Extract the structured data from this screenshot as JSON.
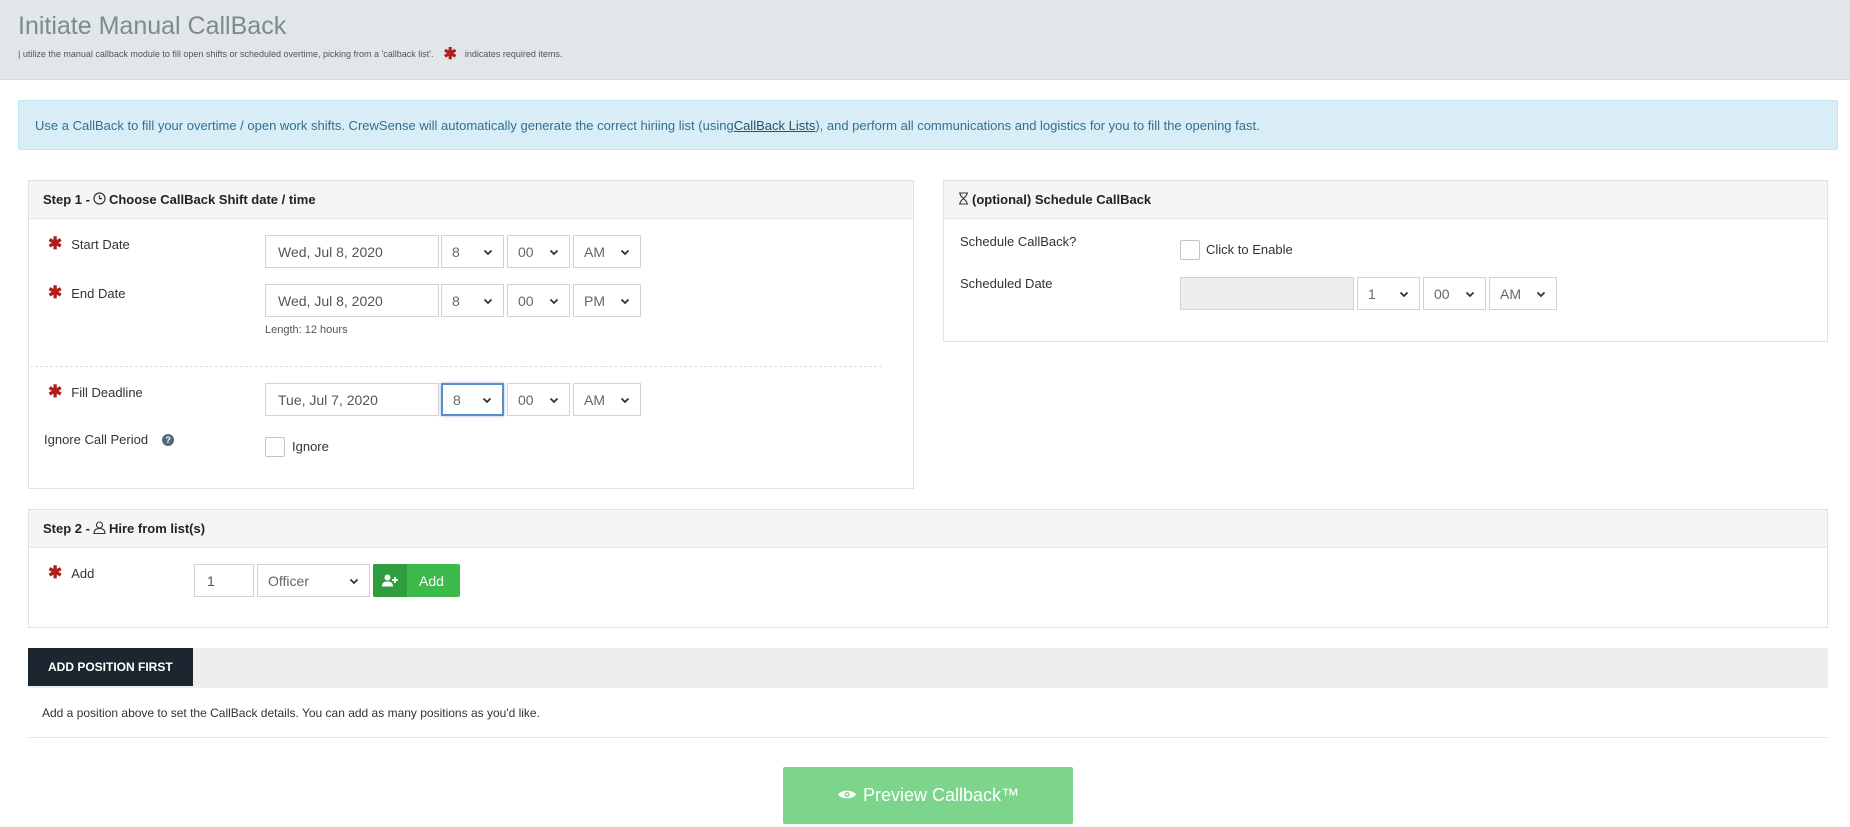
{
  "header": {
    "title": "Initiate Manual CallBack",
    "subtitle": "| utilize the manual callback module to fill open shifts or scheduled overtime, picking from a 'callback list'.",
    "required_star": "✱",
    "required_note": "indicates required items."
  },
  "banner": {
    "text_before": "Use a CallBack to fill your overtime / open work shifts. CrewSense will automatically generate the correct hiriing list (using ",
    "link": "CallBack Lists",
    "text_after": "), and perform all communications and logistics for you to fill the opening fast."
  },
  "step1": {
    "title_prefix": "Step 1 -",
    "title": "Choose CallBack Shift date / time",
    "start": {
      "label": "Start Date",
      "date": "Wed, Jul 8, 2020",
      "hour": "8",
      "minute": "00",
      "ampm": "AM"
    },
    "end": {
      "label": "End Date",
      "date": "Wed, Jul 8, 2020",
      "hour": "8",
      "minute": "00",
      "ampm": "PM"
    },
    "length": "Length: 12 hours",
    "deadline": {
      "label": "Fill Deadline",
      "date": "Tue, Jul 7, 2020",
      "hour": "8",
      "minute": "00",
      "ampm": "AM"
    },
    "ignore": {
      "label": "Ignore Call Period",
      "help": "?",
      "checkbox_label": "Ignore"
    }
  },
  "schedule": {
    "title": "(optional) Schedule CallBack",
    "schedule_label": "Schedule CallBack?",
    "enable_label": "Click to Enable",
    "date_label": "Scheduled Date",
    "date_value": "",
    "hour": "1",
    "minute": "00",
    "ampm": "AM"
  },
  "step2": {
    "title_prefix": "Step 2 -",
    "title": "Hire from list(s)",
    "add_label": "Add",
    "quantity": "1",
    "position": "Officer",
    "add_button": "Add"
  },
  "positions": {
    "tab": "ADD POSITION FIRST",
    "message": "Add a position above to set the CallBack details. You can add as many positions as you'd like."
  },
  "preview_button": "Preview Callback™",
  "colors": {
    "header_bg": "#e1e6e9",
    "banner_bg": "#d9edf7",
    "required": "#b01d1d",
    "add_green": "#3cba4b",
    "preview_green": "#7dd58c",
    "tab_dark": "#1b2631"
  },
  "icons": [
    "clock-icon",
    "hourglass-icon",
    "user-icon",
    "add-user-icon",
    "eye-icon",
    "question-icon",
    "chevron-down-icon"
  ]
}
